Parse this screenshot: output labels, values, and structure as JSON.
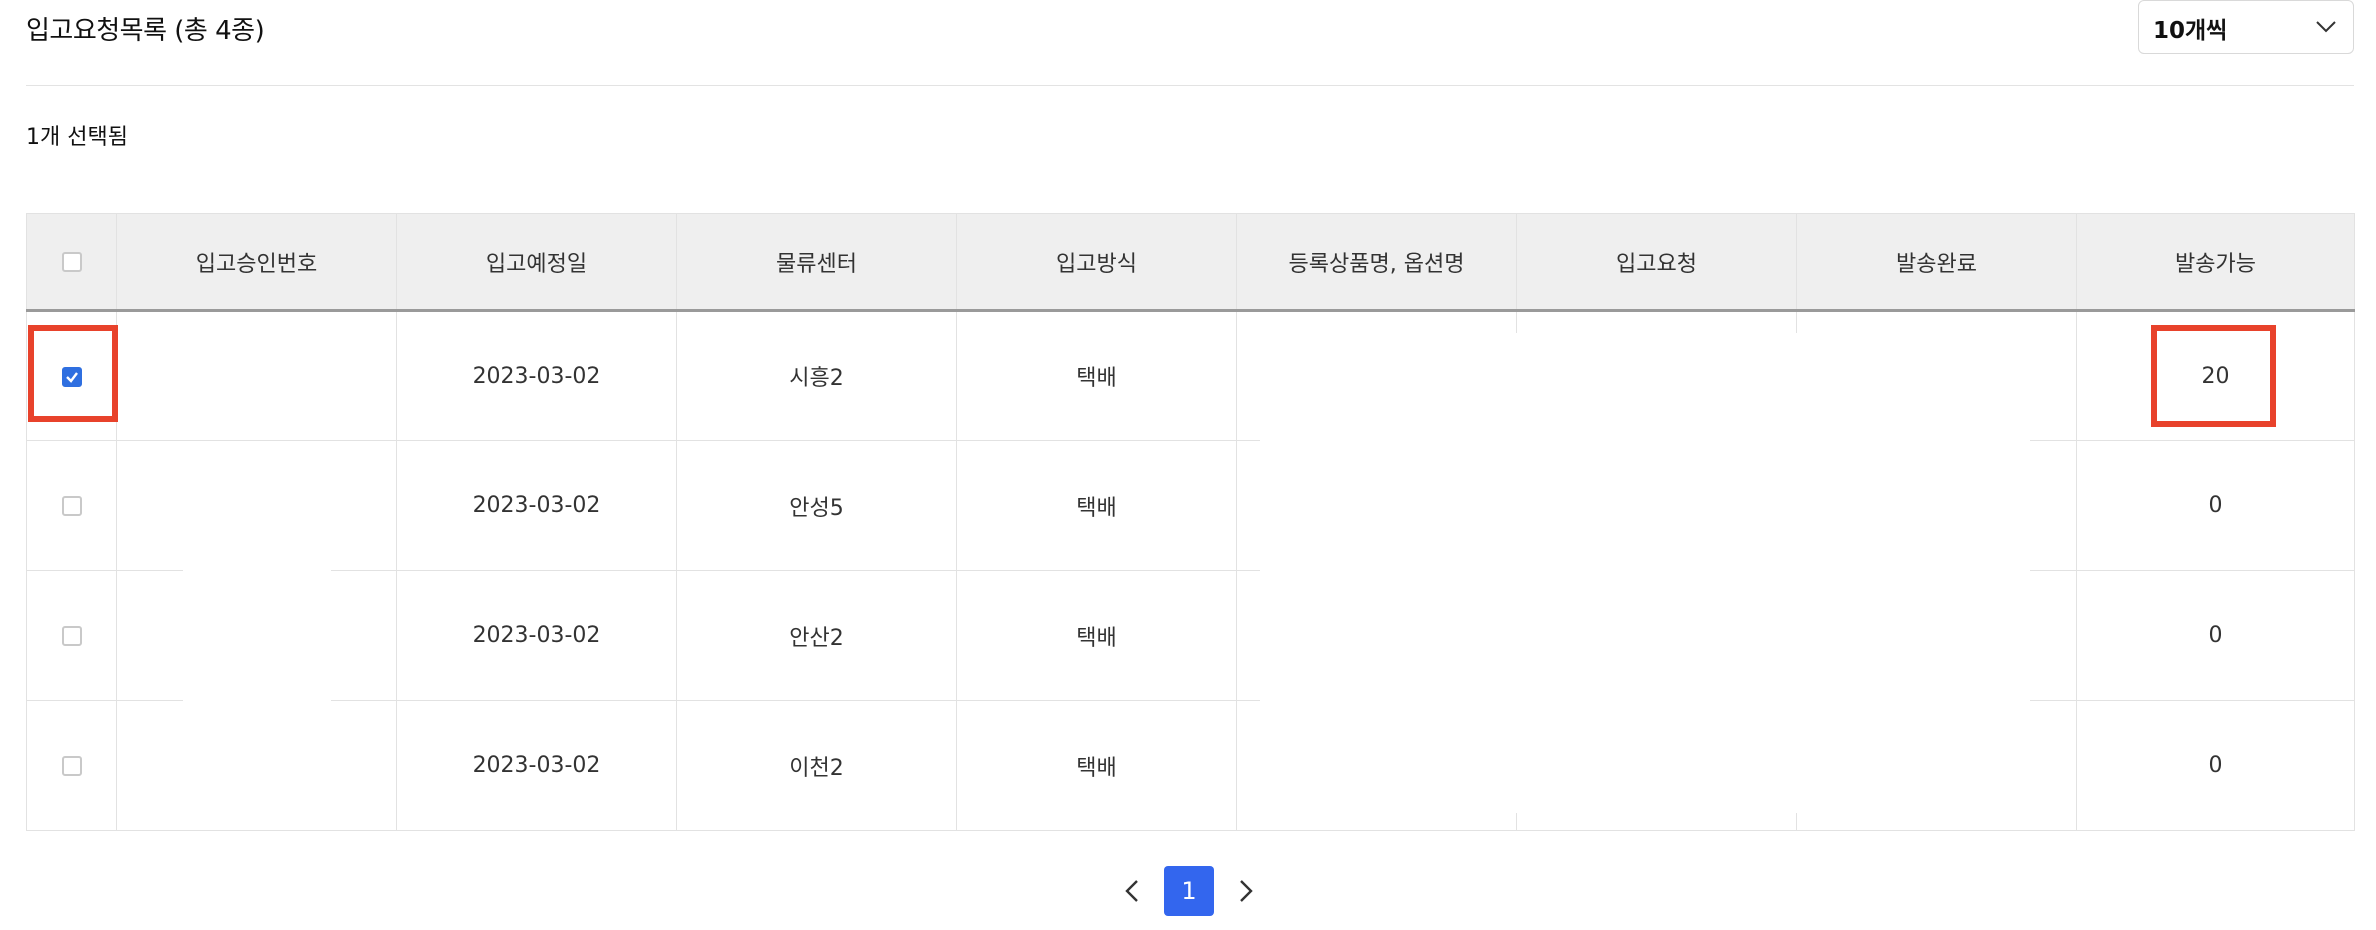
{
  "header": {
    "title": "입고요청목록 (총 4종)",
    "page_size": "10개씩",
    "selected_text": "1개 선택됨"
  },
  "table": {
    "columns": [
      "입고승인번호",
      "입고예정일",
      "물류센터",
      "입고방식",
      "등록상품명, 옵션명",
      "입고요청",
      "발송완료",
      "발송가능"
    ],
    "rows": [
      {
        "checked": true,
        "approval_no": "",
        "date": "2023-03-02",
        "center": "시흥2",
        "method": "택배",
        "product": "",
        "requested": "",
        "shipped": "",
        "available": "20"
      },
      {
        "checked": false,
        "approval_no": "",
        "date": "2023-03-02",
        "center": "안성5",
        "method": "택배",
        "product": "",
        "requested": "",
        "shipped": "",
        "available": "0"
      },
      {
        "checked": false,
        "approval_no": "",
        "date": "2023-03-02",
        "center": "안산2",
        "method": "택배",
        "product": "",
        "requested": "",
        "shipped": "",
        "available": "0"
      },
      {
        "checked": false,
        "approval_no": "",
        "date": "2023-03-02",
        "center": "이천2",
        "method": "택배",
        "product": "",
        "requested": "",
        "shipped": "",
        "available": "0"
      }
    ]
  },
  "pagination": {
    "current": "1"
  },
  "colors": {
    "accent": "#3366ee",
    "checkbox_checked": "#2f6fe0",
    "highlight": "#e8422b",
    "header_bg": "#efefef"
  },
  "icons": [
    "chevron-down-icon",
    "chevron-left-icon",
    "chevron-right-icon",
    "check-icon"
  ]
}
